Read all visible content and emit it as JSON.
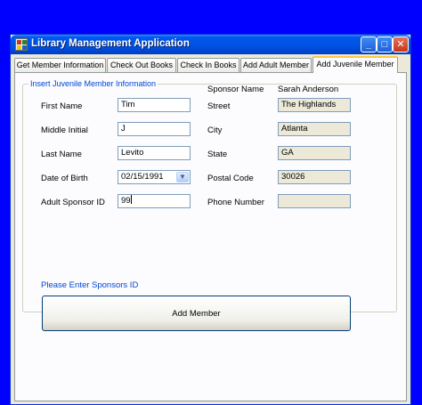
{
  "window": {
    "title": "Library Management Application",
    "minimize_glyph": "_",
    "maximize_glyph": "□",
    "close_glyph": "✕"
  },
  "tabs": [
    {
      "label": "Get Member Information",
      "active": false
    },
    {
      "label": "Check Out Books",
      "active": false
    },
    {
      "label": "Check In Books",
      "active": false
    },
    {
      "label": "Add Adult Member",
      "active": false
    },
    {
      "label": "Add Juvenile Member",
      "active": true
    }
  ],
  "form": {
    "group_label": "Insert Juvenile Member Information",
    "first_name": {
      "label": "First Name",
      "value": "Tim"
    },
    "middle_initial": {
      "label": "Middle Initial",
      "value": "J"
    },
    "last_name": {
      "label": "Last Name",
      "value": "Levito"
    },
    "date_of_birth": {
      "label": "Date of Birth",
      "value": "02/15/1991"
    },
    "adult_sponsor_id": {
      "label": "Adult Sponsor ID",
      "value": "99"
    },
    "sponsor_name": {
      "label": "Sponsor Name",
      "value": "Sarah Anderson"
    },
    "street": {
      "label": "Street",
      "value": "The Highlands"
    },
    "city": {
      "label": "City",
      "value": "Atlanta"
    },
    "state": {
      "label": "State",
      "value": "GA"
    },
    "postal_code": {
      "label": "Postal Code",
      "value": "30026"
    },
    "phone_number": {
      "label": "Phone Number",
      "value": ""
    }
  },
  "hint": "Please Enter Sponsors ID",
  "add_button_label": "Add Member",
  "colors": {
    "desktop": "#0000fe",
    "titlebar": "#0054e3",
    "accent_text": "#0046d5",
    "active_tab_highlight": "#ffc83c"
  }
}
